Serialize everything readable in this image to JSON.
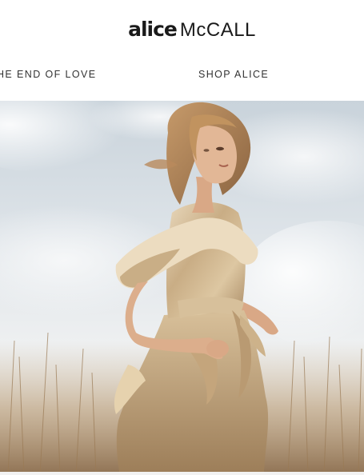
{
  "brand": {
    "logo_script": "alice",
    "logo_name": "McCALL"
  },
  "nav": {
    "items": [
      {
        "label": "HE END OF LOVE"
      },
      {
        "label": "SHOP ALICE"
      }
    ]
  },
  "hero": {
    "image_subject": "model-photo"
  }
}
